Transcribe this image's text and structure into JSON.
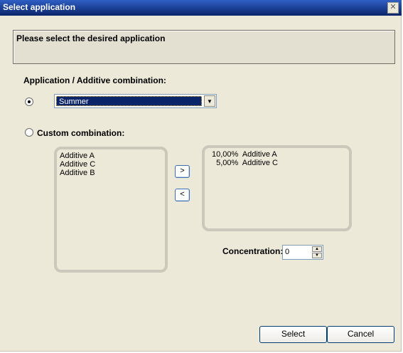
{
  "window": {
    "title": "Select application",
    "close_glyph": "✕"
  },
  "header": {
    "text": "Please select the desired application"
  },
  "app_combo": {
    "label": "Application / Additive combination:",
    "selected": "Summer",
    "arrow_glyph": "▼"
  },
  "custom": {
    "label": "Custom combination:"
  },
  "available_additives": [
    "Additive A",
    "Additive C",
    "Additive B"
  ],
  "selected_additives": [
    "10,00%  Additive A",
    "  5,00%  Additive C"
  ],
  "move": {
    "add_glyph": ">",
    "remove_glyph": "<"
  },
  "concentration": {
    "label": "Concentration:",
    "value": "0",
    "up_glyph": "▲",
    "down_glyph": "▼"
  },
  "buttons": {
    "select": "Select",
    "cancel": "Cancel"
  },
  "colors": {
    "titlebar": "#0a246a",
    "dialog_bg": "#ece9d8",
    "selection": "#0a246a"
  }
}
